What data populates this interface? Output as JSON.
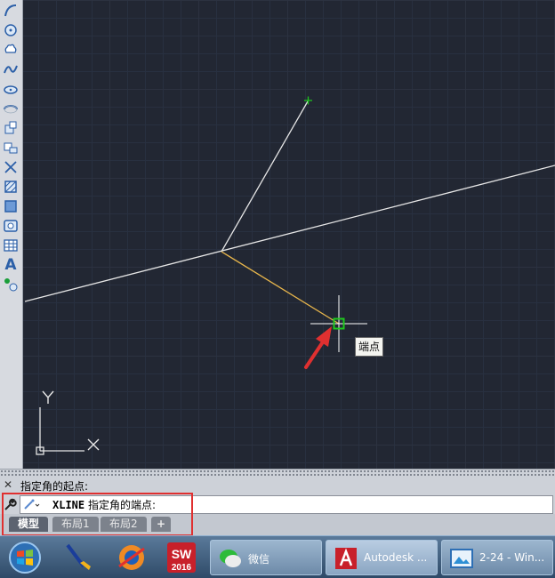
{
  "canvas": {
    "tooltip": "端点",
    "ucs": {
      "x_label": "X",
      "y_label": "Y"
    },
    "colors": {
      "background": "#222733",
      "lines": "#e6e6e6",
      "preview_line": "#e8b64c",
      "snap": "#1ec81e",
      "arrow": "#e03030"
    }
  },
  "toolbar": {
    "icons": [
      "spline-icon",
      "circle-icon",
      "revision-cloud-icon",
      "spline-fit-icon",
      "ellipse-icon",
      "ellipse-arc-icon",
      "insert-block-icon",
      "make-block-icon",
      "point-icon",
      "hatch-icon",
      "gradient-icon",
      "region-icon",
      "table-icon",
      "text-icon",
      "add-selected-icon"
    ],
    "text_label": "A"
  },
  "command": {
    "history": "指定角的起点:",
    "command_name": "XLINE",
    "prompt": "指定角的端点:"
  },
  "layout_tabs": [
    {
      "label": "模型",
      "active": true
    },
    {
      "label": "布局1",
      "active": false
    },
    {
      "label": "布局2",
      "active": false
    }
  ],
  "add_tab_label": "+",
  "taskbar": {
    "wechat_label": "微信",
    "autocad_label": "Autodesk ...",
    "image_label": "2-24 - Win...",
    "solidworks_badge": "2016",
    "solidworks_text": "SW"
  }
}
